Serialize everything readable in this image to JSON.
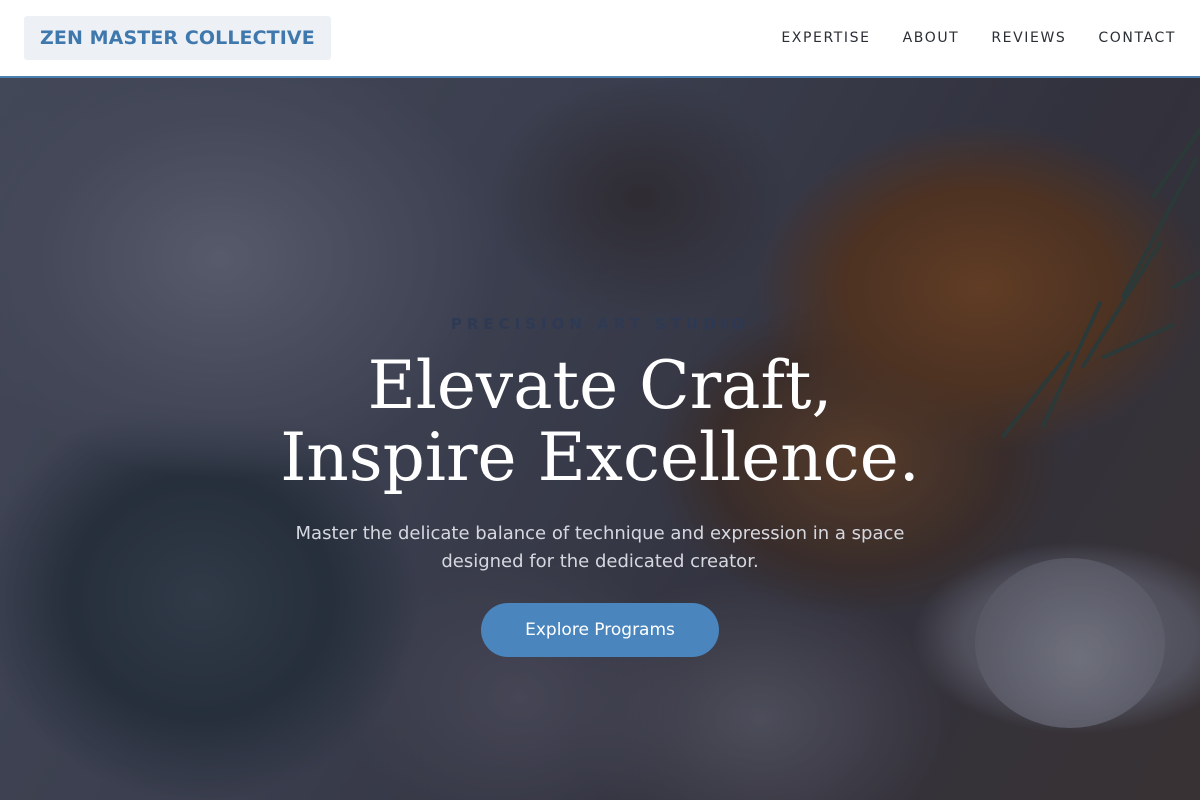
{
  "header": {
    "logo": "ZEN MASTER COLLECTIVE",
    "nav": [
      "EXPERTISE",
      "ABOUT",
      "REVIEWS",
      "CONTACT"
    ]
  },
  "hero": {
    "eyebrow": "PRECISION ART STUDIO",
    "headline_line1": "Elevate Craft,",
    "headline_line2": "Inspire Excellence.",
    "subtext": "Master the delicate balance of technique and expression in a space designed for the dedicated creator.",
    "cta_label": "Explore Programs"
  },
  "colors": {
    "accent": "#4a85bd",
    "logo_text": "#3f78ad",
    "logo_bg": "#edf1f6",
    "header_border": "#4a7fb0"
  }
}
